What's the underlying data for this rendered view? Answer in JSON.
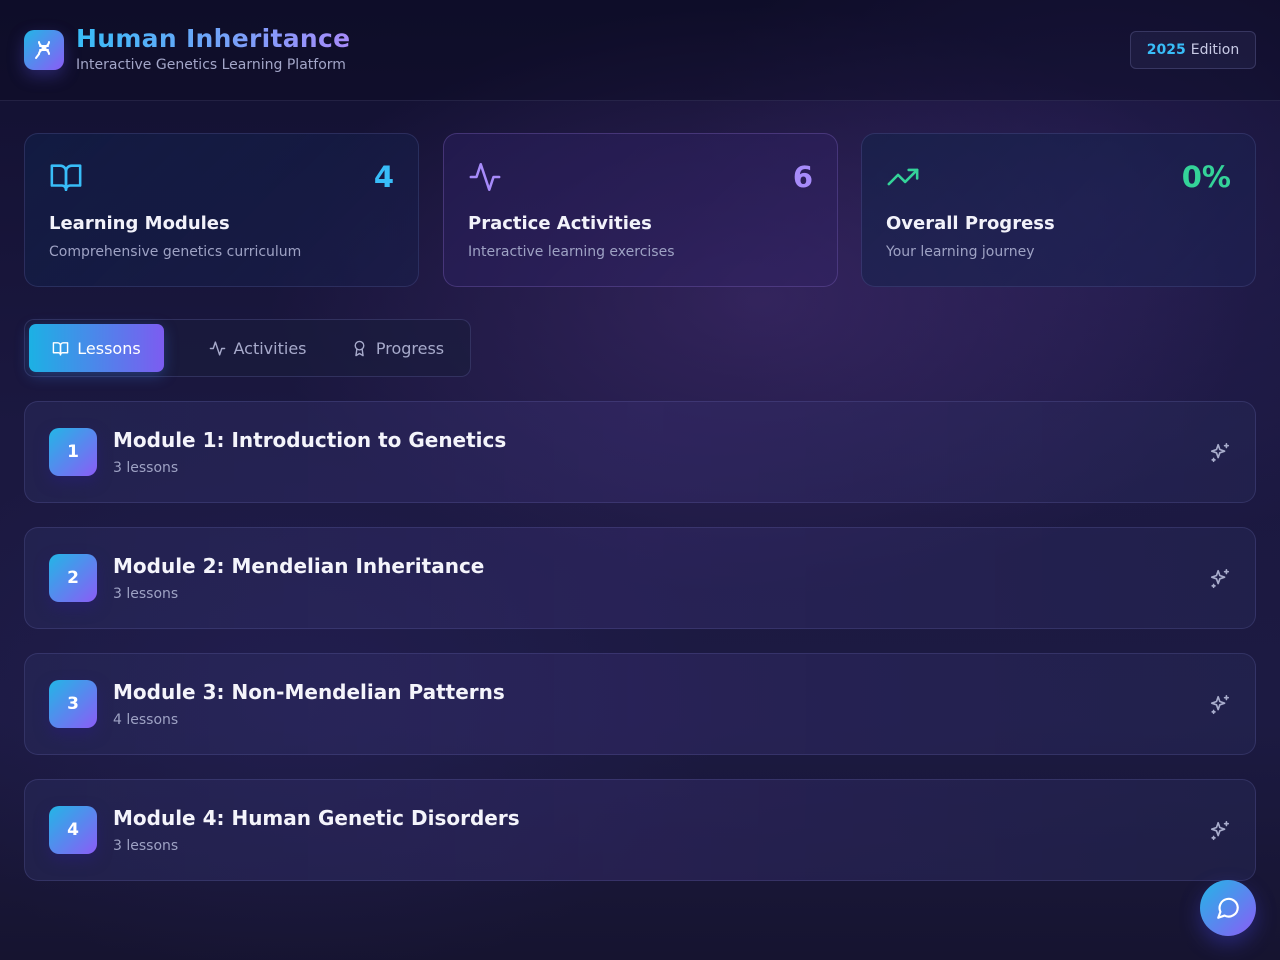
{
  "header": {
    "title": "Human Inheritance",
    "subtitle": "Interactive Genetics Learning Platform",
    "logo_icon": "dna-icon",
    "edition_year": "2025",
    "edition_label": "Edition"
  },
  "stats": [
    {
      "value": "4",
      "title": "Learning Modules",
      "description": "Comprehensive genetics curriculum",
      "icon": "book-open-icon",
      "color": "#38bdf8"
    },
    {
      "value": "6",
      "title": "Practice Activities",
      "description": "Interactive learning exercises",
      "icon": "activity-icon",
      "color": "#a78bfa"
    },
    {
      "value": "0%",
      "title": "Overall Progress",
      "description": "Your learning journey",
      "icon": "trending-up-icon",
      "color": "#34d399"
    }
  ],
  "tabs": [
    {
      "label": "Lessons",
      "icon": "book-open-icon",
      "active": true
    },
    {
      "label": "Activities",
      "icon": "activity-icon",
      "active": false
    },
    {
      "label": "Progress",
      "icon": "award-icon",
      "active": false
    }
  ],
  "modules": [
    {
      "number": "1",
      "title": "Module 1: Introduction to Genetics",
      "lessons": "3 lessons"
    },
    {
      "number": "2",
      "title": "Module 2: Mendelian Inheritance",
      "lessons": "3 lessons"
    },
    {
      "number": "3",
      "title": "Module 3: Non-Mendelian Patterns",
      "lessons": "4 lessons"
    },
    {
      "number": "4",
      "title": "Module 4: Human Genetic Disorders",
      "lessons": "3 lessons"
    }
  ],
  "module_action_icon": "sparkles-icon",
  "chat_icon": "message-circle-icon",
  "colors": {
    "accent_blue": "#22b6e6",
    "accent_purple": "#8b5cf6",
    "progress_green": "#34d399"
  }
}
